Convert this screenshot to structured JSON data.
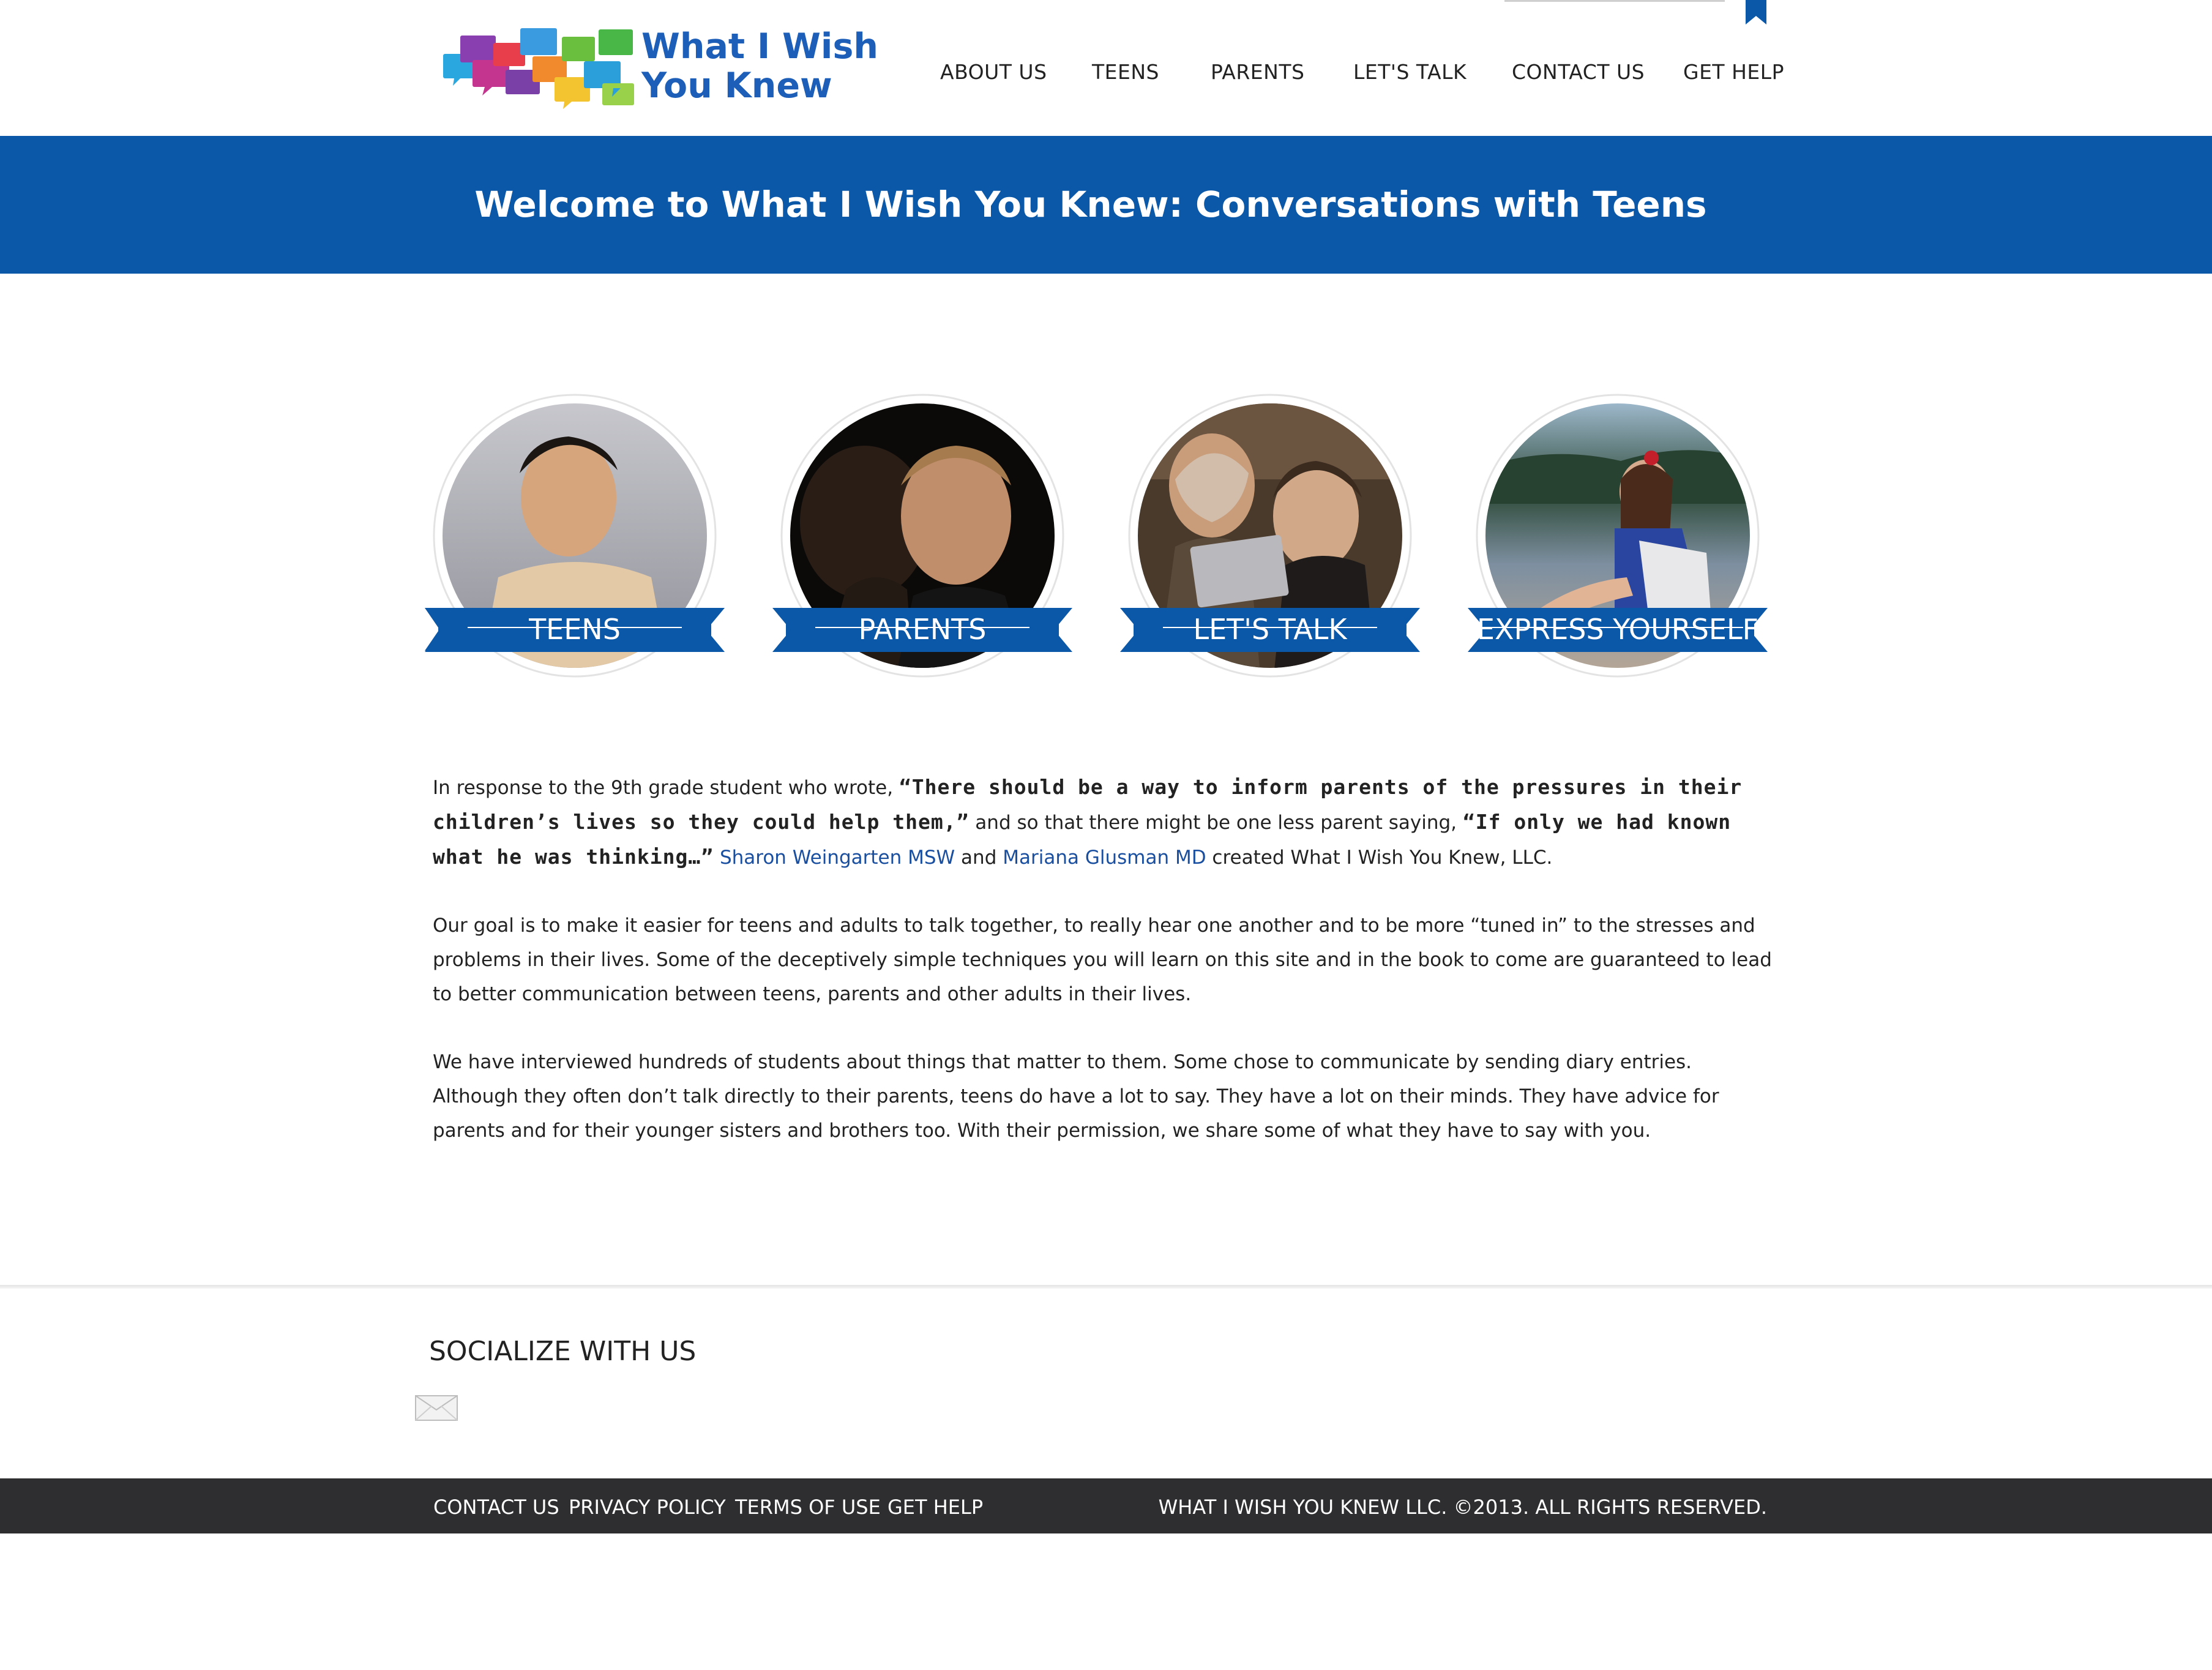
{
  "header": {
    "logo_line1": "What I Wish",
    "logo_line2": "You Knew",
    "nav": [
      "ABOUT US",
      "TEENS",
      "PARENTS",
      "LET'S TALK",
      "CONTACT US",
      "GET HELP"
    ]
  },
  "banner": {
    "title": "Welcome to What I Wish You Knew: Conversations with Teens"
  },
  "circles": [
    {
      "label": "TEENS"
    },
    {
      "label": "PARENTS"
    },
    {
      "label": "LET'S TALK"
    },
    {
      "label": "EXPRESS YOURSELF"
    }
  ],
  "content": {
    "p1_a": "In response to the 9th grade student who wrote, ",
    "p1_quote1": "“There should be a way to inform parents of the pressures in their children’s lives so they could help them,”",
    "p1_b": " and so that there might be one less parent saying, ",
    "p1_quote2": "“If only we had known what he was thinking…”",
    "p1_c": " ",
    "p1_link1": "Sharon Weingarten MSW",
    "p1_d": " and ",
    "p1_link2": "Mariana Glusman MD",
    "p1_e": " created What I Wish You Knew, LLC.",
    "p2": "Our goal is to make it easier for teens and adults to talk together, to really hear one another and to be more “tuned in” to the stresses and problems in their lives. Some of the deceptively simple techniques you will learn on this site and in the book to come are guaranteed to lead to better communication between teens, parents and other adults in their lives.",
    "p3": "We have interviewed hundreds of students about things that matter to them. Some chose to communicate by sending diary entries. Although they often don’t talk directly to their parents, teens do have a lot to say. They have a lot on their minds. They have advice for parents and for their younger sisters and brothers too. With their permission, we share some of what they have to say with you."
  },
  "social": {
    "title": "SOCIALIZE WITH US",
    "icon": "mail-icon"
  },
  "footer": {
    "links": [
      "CONTACT US",
      "PRIVACY POLICY",
      "TERMS OF USE",
      "GET HELP"
    ],
    "copyright": "WHAT I WISH YOU KNEW LLC. ©2013. ALL RIGHTS RESERVED."
  },
  "colors": {
    "brand_blue": "#0b57a8",
    "link_blue": "#1a4fa0",
    "footer_bg": "#2e2e30"
  }
}
